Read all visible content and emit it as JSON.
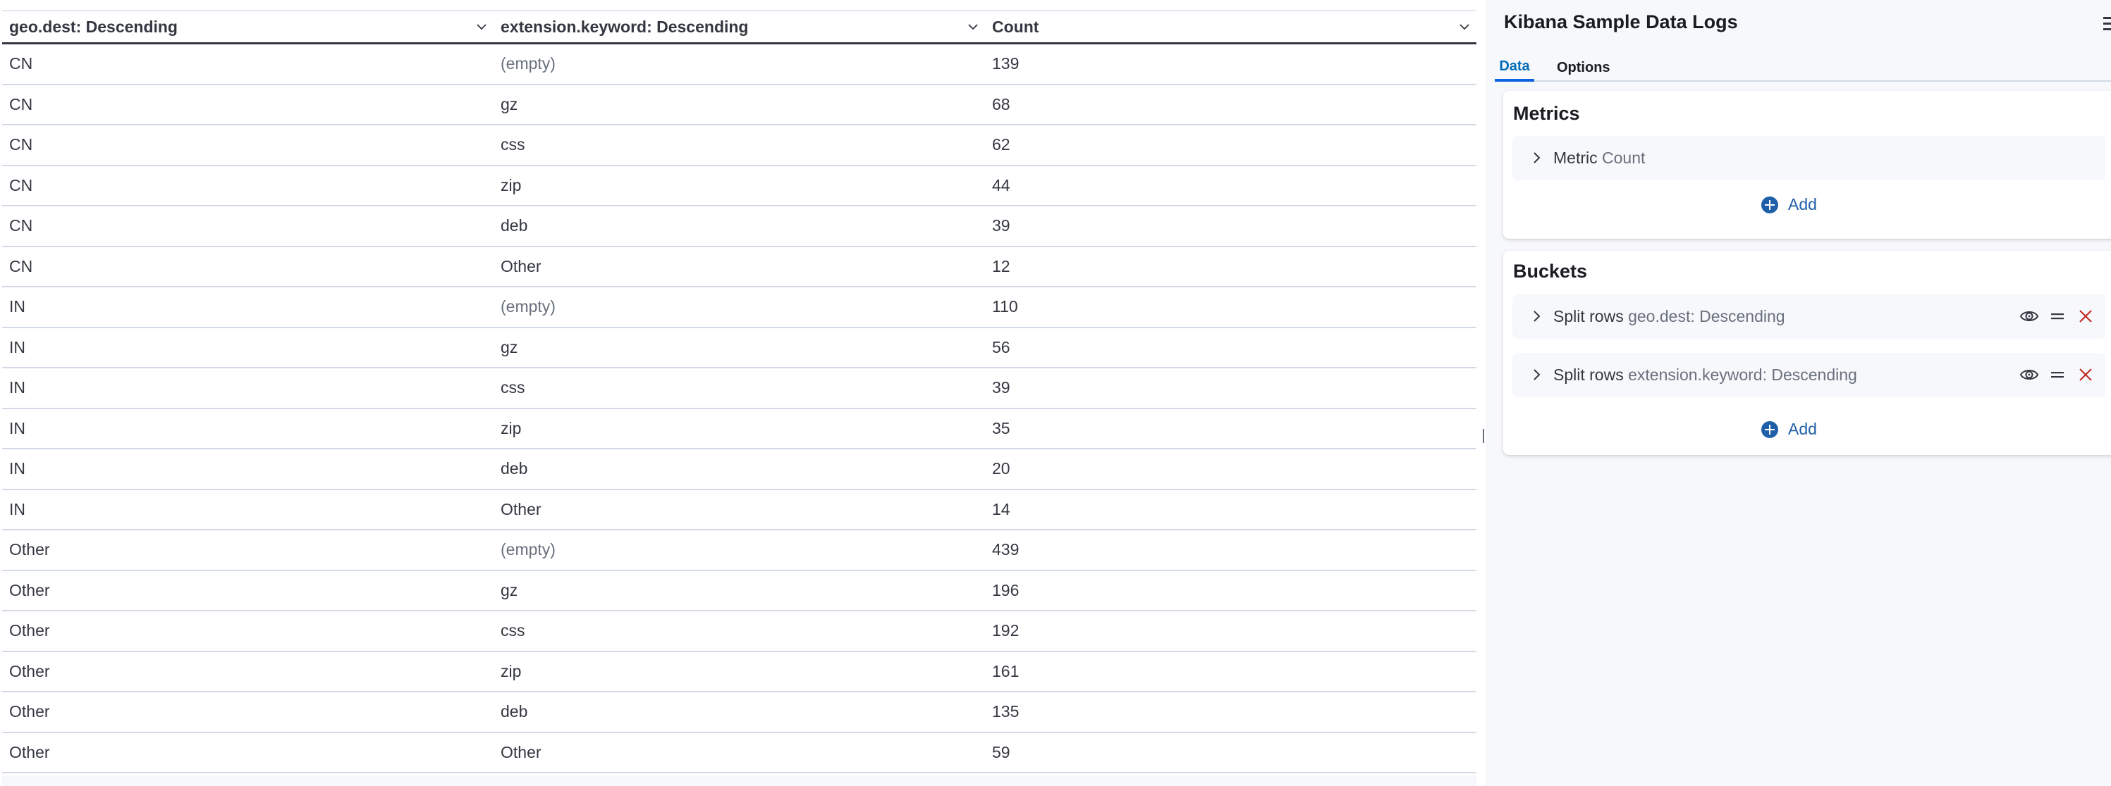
{
  "table": {
    "columns": [
      {
        "label": "geo.dest: Descending",
        "sort_icon": "chevron-down-icon"
      },
      {
        "label": "extension.keyword: Descending",
        "sort_icon": "chevron-down-icon"
      },
      {
        "label": "Count",
        "sort_icon": "chevron-down-icon"
      }
    ],
    "rows": [
      {
        "geo": "CN",
        "ext": "(empty)",
        "count": "139",
        "ext_muted": true
      },
      {
        "geo": "CN",
        "ext": "gz",
        "count": "68",
        "ext_muted": false
      },
      {
        "geo": "CN",
        "ext": "css",
        "count": "62",
        "ext_muted": false
      },
      {
        "geo": "CN",
        "ext": "zip",
        "count": "44",
        "ext_muted": false
      },
      {
        "geo": "CN",
        "ext": "deb",
        "count": "39",
        "ext_muted": false
      },
      {
        "geo": "CN",
        "ext": "Other",
        "count": "12",
        "ext_muted": false
      },
      {
        "geo": "IN",
        "ext": "(empty)",
        "count": "110",
        "ext_muted": true
      },
      {
        "geo": "IN",
        "ext": "gz",
        "count": "56",
        "ext_muted": false
      },
      {
        "geo": "IN",
        "ext": "css",
        "count": "39",
        "ext_muted": false
      },
      {
        "geo": "IN",
        "ext": "zip",
        "count": "35",
        "ext_muted": false
      },
      {
        "geo": "IN",
        "ext": "deb",
        "count": "20",
        "ext_muted": false
      },
      {
        "geo": "IN",
        "ext": "Other",
        "count": "14",
        "ext_muted": false
      },
      {
        "geo": "Other",
        "ext": "(empty)",
        "count": "439",
        "ext_muted": true
      },
      {
        "geo": "Other",
        "ext": "gz",
        "count": "196",
        "ext_muted": false
      },
      {
        "geo": "Other",
        "ext": "css",
        "count": "192",
        "ext_muted": false
      },
      {
        "geo": "Other",
        "ext": "zip",
        "count": "161",
        "ext_muted": false
      },
      {
        "geo": "Other",
        "ext": "deb",
        "count": "135",
        "ext_muted": false
      },
      {
        "geo": "Other",
        "ext": "Other",
        "count": "59",
        "ext_muted": false
      }
    ]
  },
  "panel": {
    "title": "Kibana Sample Data Logs",
    "menu_icon": "menu-collapse-icon",
    "tabs": [
      {
        "label": "Data",
        "active": true
      },
      {
        "label": "Options",
        "active": false
      }
    ],
    "metrics": {
      "title": "Metrics",
      "items": [
        {
          "type": "Metric",
          "description": "Count"
        }
      ],
      "add_label": "Add"
    },
    "buckets": {
      "title": "Buckets",
      "items": [
        {
          "type": "Split rows",
          "description": "geo.dest: Descending"
        },
        {
          "type": "Split rows",
          "description": "extension.keyword: Descending"
        }
      ],
      "add_label": "Add"
    }
  },
  "colors": {
    "accent": "#0b64dd",
    "add_button": "#1f5fa8",
    "remove_icon": "#bd271e",
    "text": "#343741",
    "muted_text": "#69707d",
    "panel_bg": "#f7f8fc"
  }
}
